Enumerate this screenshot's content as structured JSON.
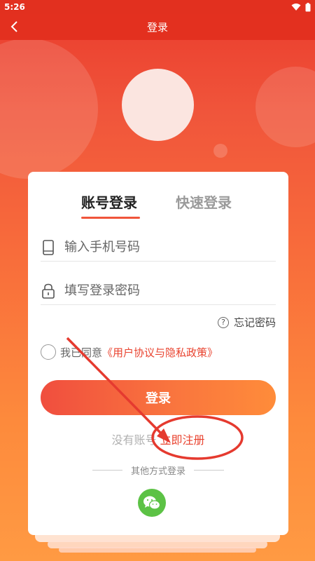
{
  "status_bar": {
    "time": "5:26"
  },
  "app_bar": {
    "title": "登录"
  },
  "tabs": [
    {
      "label": "账号登录",
      "active": true
    },
    {
      "label": "快速登录",
      "active": false
    }
  ],
  "form": {
    "phone_placeholder": "输入手机号码",
    "password_placeholder": "填写登录密码",
    "forgot_label": "忘记密码"
  },
  "agreement": {
    "prefix": "我已同意",
    "link": "《用户协议与隐私政策》"
  },
  "login_button": "登录",
  "register": {
    "prompt": "没有账号",
    "link": "立即注册"
  },
  "other_login": {
    "label": "其他方式登录",
    "wechat_icon": "wechat-icon"
  },
  "colors": {
    "accent": "#e9432f",
    "wechat": "#5cc245",
    "header": "#e3301f"
  }
}
